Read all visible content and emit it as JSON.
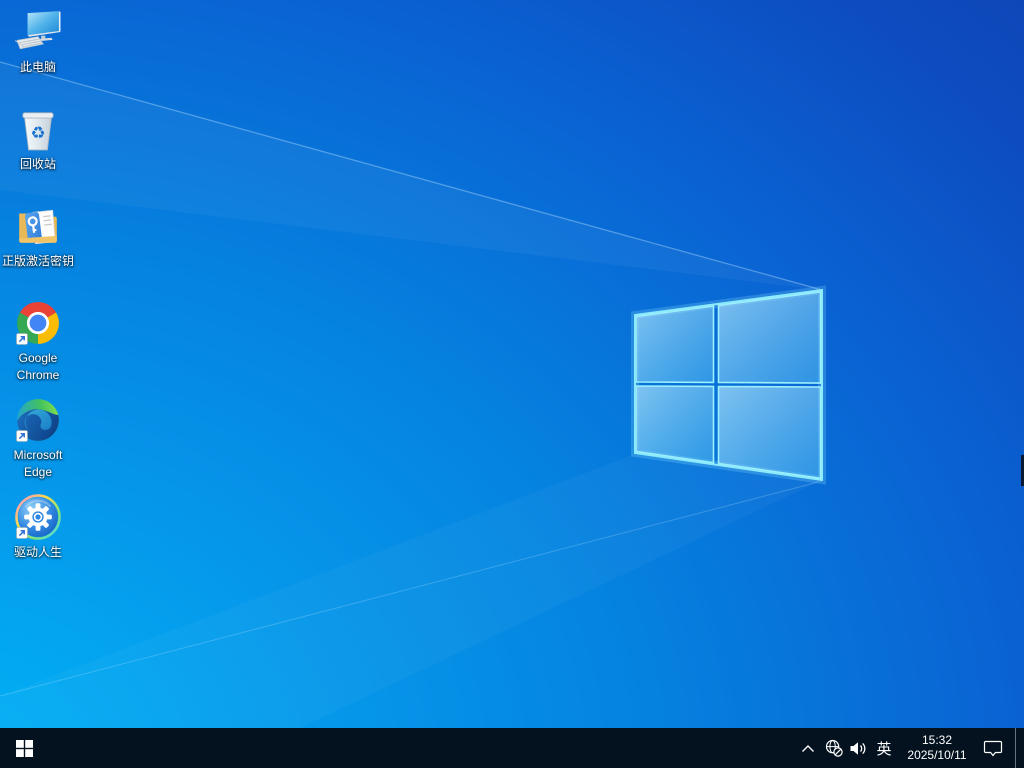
{
  "desktop": {
    "icons": [
      {
        "label": "此电脑"
      },
      {
        "label": "回收站"
      },
      {
        "label": "正版激活密钥"
      },
      {
        "label": "Google Chrome"
      },
      {
        "label": "Microsoft Edge"
      },
      {
        "label": "驱动人生"
      }
    ]
  },
  "taskbar": {
    "language_indicator": "英",
    "clock": {
      "time": "15:32",
      "date": "2025/10/11"
    }
  },
  "colors": {
    "taskbar_background": "#03121e",
    "wallpaper_bright": "#00b2f6",
    "wallpaper_deep": "#0e45b4",
    "logo_border": "#8beafc",
    "icon_label": "#ffffff"
  }
}
